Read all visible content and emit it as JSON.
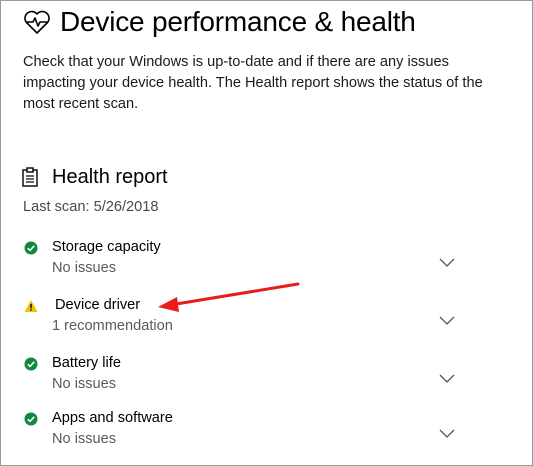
{
  "header": {
    "title": "Device performance & health",
    "icon": "heart-pulse-icon",
    "description": "Check that your Windows is up-to-date and if there are any issues impacting your device health. The Health report shows the status of the most recent scan."
  },
  "health_report": {
    "title": "Health report",
    "icon": "clipboard-icon",
    "last_scan": "Last scan: 5/26/2018",
    "items": [
      {
        "name": "Storage capacity",
        "status_text": "No issues",
        "status": "ok"
      },
      {
        "name": "Device driver",
        "status_text": "1 recommendation",
        "status": "warning"
      },
      {
        "name": "Battery life",
        "status_text": "No issues",
        "status": "ok"
      },
      {
        "name": "Apps and software",
        "status_text": "No issues",
        "status": "ok"
      }
    ]
  },
  "colors": {
    "ok": "#10893e",
    "warning": "#f2c200",
    "annotation_arrow": "#e81c1c",
    "chevron": "#555555"
  }
}
